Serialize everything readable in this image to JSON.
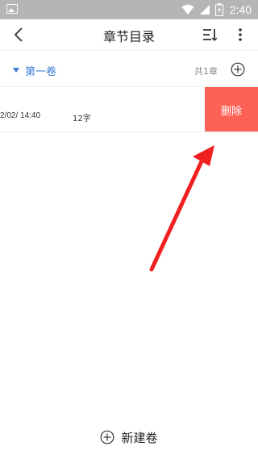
{
  "status_bar": {
    "time": "2:40",
    "icons": [
      "gallery-icon",
      "wifi-icon",
      "signal-icon",
      "battery-icon"
    ]
  },
  "app_bar": {
    "title": "章节目录",
    "icons": [
      "back-icon",
      "sort-icon",
      "more-vert-icon"
    ]
  },
  "volume": {
    "name": "第一卷",
    "chapter_count": "共1章",
    "icons": [
      "caret-down-icon",
      "add-circle-icon"
    ]
  },
  "chapter": {
    "date": "2/02/ 14:40",
    "word_count": "12字",
    "delete_label": "删除"
  },
  "footer": {
    "new_volume_label": "新建卷",
    "icon": "add-circle-icon"
  },
  "colors": {
    "accent": "#3a7bd5",
    "delete_bg": "#fd6257",
    "status_bar_bg": "#b5b5b5",
    "annotation_arrow": "#f02020"
  }
}
